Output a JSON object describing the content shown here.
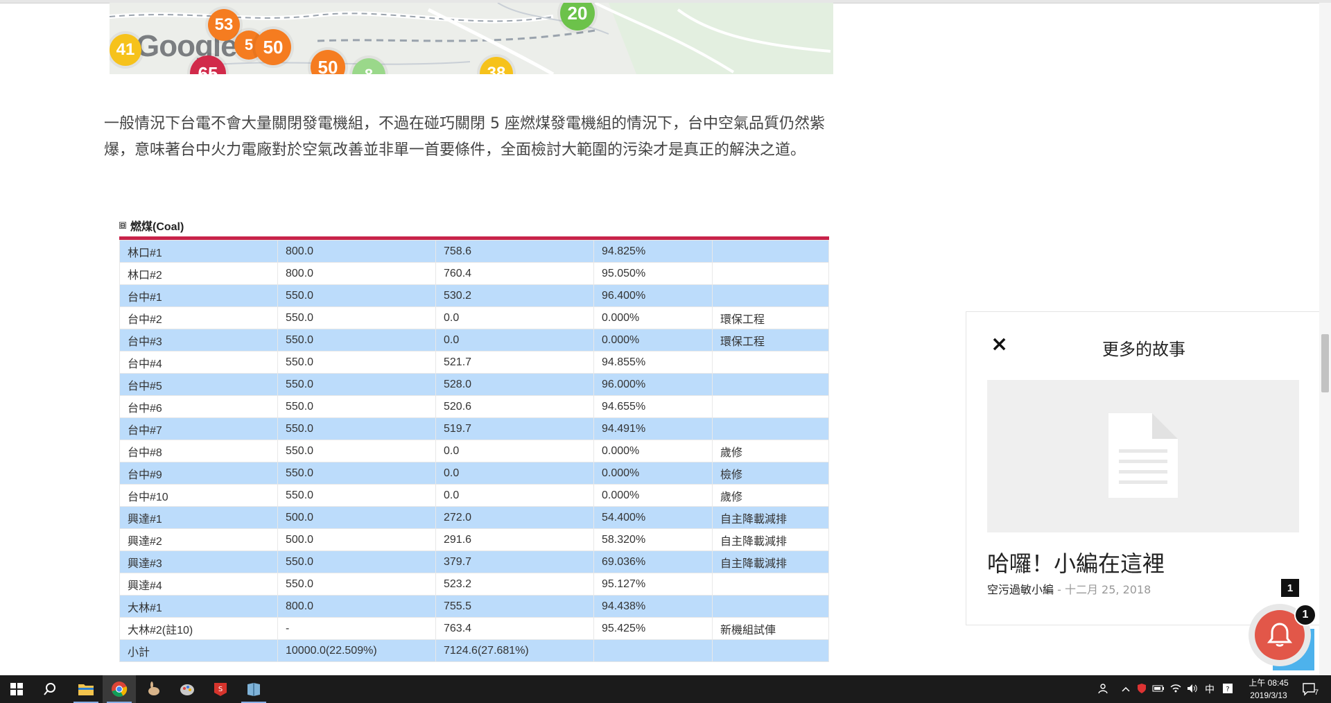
{
  "map": {
    "brand": "Google",
    "markers": [
      {
        "value": "53",
        "color": "#f57c20"
      },
      {
        "value": "41",
        "color": "#f6c21b"
      },
      {
        "value": "5",
        "color": "#f57c20"
      },
      {
        "value": "50",
        "color": "#f57c20"
      },
      {
        "value": "65",
        "color": "#d12a4a"
      },
      {
        "value": "50",
        "color": "#f57c20"
      },
      {
        "value": "8",
        "color": "#9ad88a"
      },
      {
        "value": "38",
        "color": "#f6c21b"
      },
      {
        "value": "20",
        "color": "#6cc24a"
      }
    ]
  },
  "article": {
    "paragraph": "一般情況下台電不會大量關閉發電機組，不過在碰巧關閉 5 座燃煤發電機組的情況下，台中空氣品質仍然紫爆，意味著台中火力電廠對於空氣改善並非單一首要條件，全面檢討大範圍的污染才是真正的解決之道。"
  },
  "table": {
    "toggle": "⊟",
    "title": "燃煤(Coal)",
    "accent": "#c8234a",
    "rows": [
      [
        "林口#1",
        "800.0",
        "758.6",
        "94.825%",
        ""
      ],
      [
        "林口#2",
        "800.0",
        "760.4",
        "95.050%",
        ""
      ],
      [
        "台中#1",
        "550.0",
        "530.2",
        "96.400%",
        ""
      ],
      [
        "台中#2",
        "550.0",
        "0.0",
        "0.000%",
        "環保工程"
      ],
      [
        "台中#3",
        "550.0",
        "0.0",
        "0.000%",
        "環保工程"
      ],
      [
        "台中#4",
        "550.0",
        "521.7",
        "94.855%",
        ""
      ],
      [
        "台中#5",
        "550.0",
        "528.0",
        "96.000%",
        ""
      ],
      [
        "台中#6",
        "550.0",
        "520.6",
        "94.655%",
        ""
      ],
      [
        "台中#7",
        "550.0",
        "519.7",
        "94.491%",
        ""
      ],
      [
        "台中#8",
        "550.0",
        "0.0",
        "0.000%",
        "歲修"
      ],
      [
        "台中#9",
        "550.0",
        "0.0",
        "0.000%",
        "檢修"
      ],
      [
        "台中#10",
        "550.0",
        "0.0",
        "0.000%",
        "歲修"
      ],
      [
        "興達#1",
        "500.0",
        "272.0",
        "54.400%",
        "自主降載減排"
      ],
      [
        "興達#2",
        "500.0",
        "291.6",
        "58.320%",
        "自主降載減排"
      ],
      [
        "興達#3",
        "550.0",
        "379.7",
        "69.036%",
        "自主降載減排"
      ],
      [
        "興達#4",
        "550.0",
        "523.2",
        "95.127%",
        ""
      ],
      [
        "大林#1",
        "800.0",
        "755.5",
        "94.438%",
        ""
      ],
      [
        "大林#2(註10)",
        "-",
        "763.4",
        "95.425%",
        "新機組試俥"
      ],
      [
        "小計",
        "10000.0(22.509%)",
        "7124.6(27.681%)",
        "",
        ""
      ]
    ]
  },
  "sidebar": {
    "close": "×",
    "heading": "更多的故事",
    "story_title": "哈囉！小編在這裡",
    "author": "空污過敏小編",
    "separator": " - ",
    "date": "十二月 25, 2018",
    "badge": "1"
  },
  "notification": {
    "count": "1",
    "color": "#e25749"
  },
  "taskbar": {
    "ime": "中",
    "time": "上午 08:45",
    "date": "2019/3/13",
    "notif_count": "7"
  }
}
